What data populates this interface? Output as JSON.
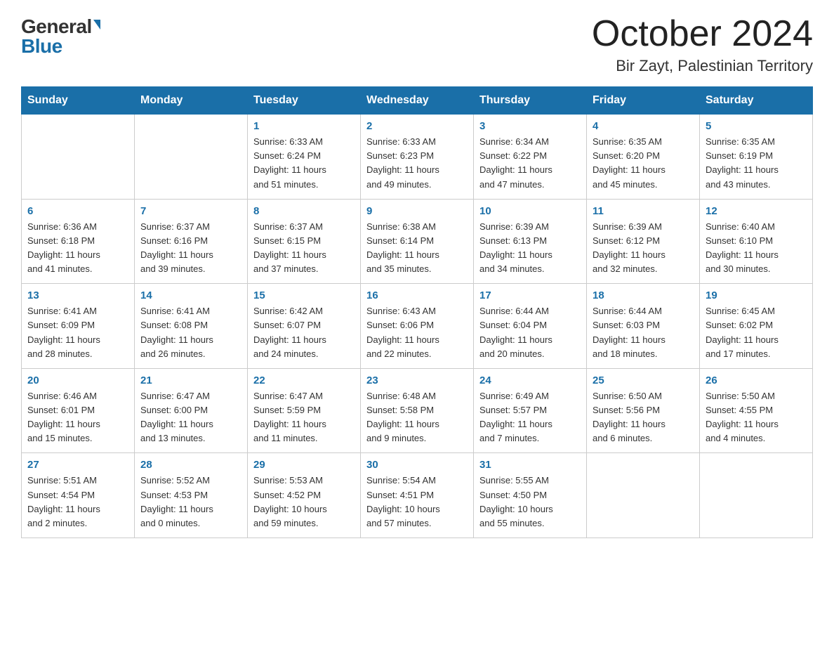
{
  "header": {
    "logo_general": "General",
    "logo_blue": "Blue",
    "month_title": "October 2024",
    "location": "Bir Zayt, Palestinian Territory"
  },
  "days_of_week": [
    "Sunday",
    "Monday",
    "Tuesday",
    "Wednesday",
    "Thursday",
    "Friday",
    "Saturday"
  ],
  "weeks": [
    [
      {
        "day": "",
        "info": ""
      },
      {
        "day": "",
        "info": ""
      },
      {
        "day": "1",
        "info": "Sunrise: 6:33 AM\nSunset: 6:24 PM\nDaylight: 11 hours\nand 51 minutes."
      },
      {
        "day": "2",
        "info": "Sunrise: 6:33 AM\nSunset: 6:23 PM\nDaylight: 11 hours\nand 49 minutes."
      },
      {
        "day": "3",
        "info": "Sunrise: 6:34 AM\nSunset: 6:22 PM\nDaylight: 11 hours\nand 47 minutes."
      },
      {
        "day": "4",
        "info": "Sunrise: 6:35 AM\nSunset: 6:20 PM\nDaylight: 11 hours\nand 45 minutes."
      },
      {
        "day": "5",
        "info": "Sunrise: 6:35 AM\nSunset: 6:19 PM\nDaylight: 11 hours\nand 43 minutes."
      }
    ],
    [
      {
        "day": "6",
        "info": "Sunrise: 6:36 AM\nSunset: 6:18 PM\nDaylight: 11 hours\nand 41 minutes."
      },
      {
        "day": "7",
        "info": "Sunrise: 6:37 AM\nSunset: 6:16 PM\nDaylight: 11 hours\nand 39 minutes."
      },
      {
        "day": "8",
        "info": "Sunrise: 6:37 AM\nSunset: 6:15 PM\nDaylight: 11 hours\nand 37 minutes."
      },
      {
        "day": "9",
        "info": "Sunrise: 6:38 AM\nSunset: 6:14 PM\nDaylight: 11 hours\nand 35 minutes."
      },
      {
        "day": "10",
        "info": "Sunrise: 6:39 AM\nSunset: 6:13 PM\nDaylight: 11 hours\nand 34 minutes."
      },
      {
        "day": "11",
        "info": "Sunrise: 6:39 AM\nSunset: 6:12 PM\nDaylight: 11 hours\nand 32 minutes."
      },
      {
        "day": "12",
        "info": "Sunrise: 6:40 AM\nSunset: 6:10 PM\nDaylight: 11 hours\nand 30 minutes."
      }
    ],
    [
      {
        "day": "13",
        "info": "Sunrise: 6:41 AM\nSunset: 6:09 PM\nDaylight: 11 hours\nand 28 minutes."
      },
      {
        "day": "14",
        "info": "Sunrise: 6:41 AM\nSunset: 6:08 PM\nDaylight: 11 hours\nand 26 minutes."
      },
      {
        "day": "15",
        "info": "Sunrise: 6:42 AM\nSunset: 6:07 PM\nDaylight: 11 hours\nand 24 minutes."
      },
      {
        "day": "16",
        "info": "Sunrise: 6:43 AM\nSunset: 6:06 PM\nDaylight: 11 hours\nand 22 minutes."
      },
      {
        "day": "17",
        "info": "Sunrise: 6:44 AM\nSunset: 6:04 PM\nDaylight: 11 hours\nand 20 minutes."
      },
      {
        "day": "18",
        "info": "Sunrise: 6:44 AM\nSunset: 6:03 PM\nDaylight: 11 hours\nand 18 minutes."
      },
      {
        "day": "19",
        "info": "Sunrise: 6:45 AM\nSunset: 6:02 PM\nDaylight: 11 hours\nand 17 minutes."
      }
    ],
    [
      {
        "day": "20",
        "info": "Sunrise: 6:46 AM\nSunset: 6:01 PM\nDaylight: 11 hours\nand 15 minutes."
      },
      {
        "day": "21",
        "info": "Sunrise: 6:47 AM\nSunset: 6:00 PM\nDaylight: 11 hours\nand 13 minutes."
      },
      {
        "day": "22",
        "info": "Sunrise: 6:47 AM\nSunset: 5:59 PM\nDaylight: 11 hours\nand 11 minutes."
      },
      {
        "day": "23",
        "info": "Sunrise: 6:48 AM\nSunset: 5:58 PM\nDaylight: 11 hours\nand 9 minutes."
      },
      {
        "day": "24",
        "info": "Sunrise: 6:49 AM\nSunset: 5:57 PM\nDaylight: 11 hours\nand 7 minutes."
      },
      {
        "day": "25",
        "info": "Sunrise: 6:50 AM\nSunset: 5:56 PM\nDaylight: 11 hours\nand 6 minutes."
      },
      {
        "day": "26",
        "info": "Sunrise: 5:50 AM\nSunset: 4:55 PM\nDaylight: 11 hours\nand 4 minutes."
      }
    ],
    [
      {
        "day": "27",
        "info": "Sunrise: 5:51 AM\nSunset: 4:54 PM\nDaylight: 11 hours\nand 2 minutes."
      },
      {
        "day": "28",
        "info": "Sunrise: 5:52 AM\nSunset: 4:53 PM\nDaylight: 11 hours\nand 0 minutes."
      },
      {
        "day": "29",
        "info": "Sunrise: 5:53 AM\nSunset: 4:52 PM\nDaylight: 10 hours\nand 59 minutes."
      },
      {
        "day": "30",
        "info": "Sunrise: 5:54 AM\nSunset: 4:51 PM\nDaylight: 10 hours\nand 57 minutes."
      },
      {
        "day": "31",
        "info": "Sunrise: 5:55 AM\nSunset: 4:50 PM\nDaylight: 10 hours\nand 55 minutes."
      },
      {
        "day": "",
        "info": ""
      },
      {
        "day": "",
        "info": ""
      }
    ]
  ]
}
